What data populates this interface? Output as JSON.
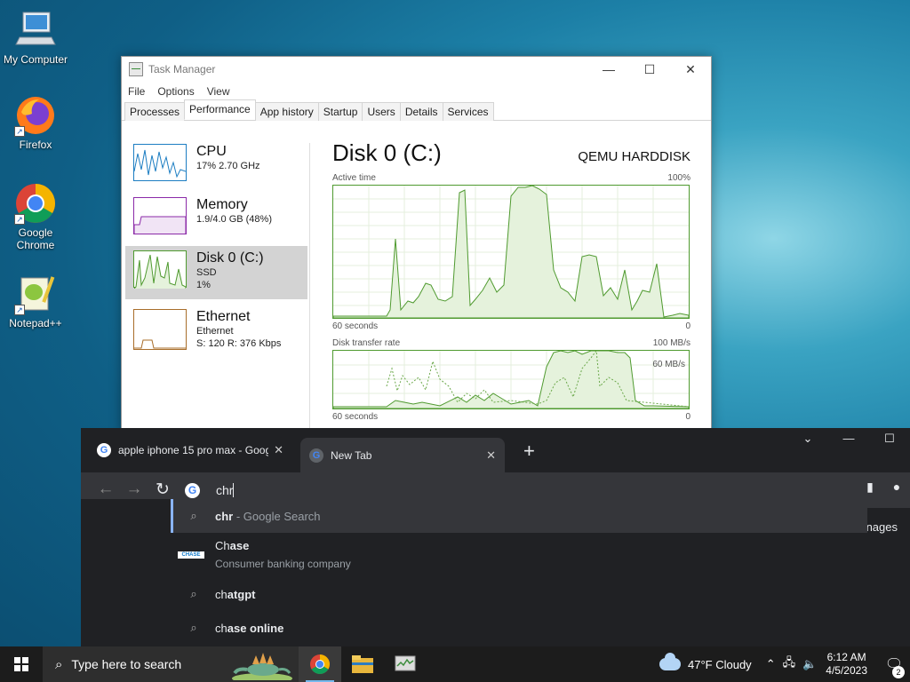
{
  "desktop": {
    "icons": [
      {
        "label": "My Computer"
      },
      {
        "label": "Firefox"
      },
      {
        "label": "Google Chrome"
      },
      {
        "label": "Notepad++"
      }
    ]
  },
  "task_manager": {
    "title": "Task Manager",
    "menu": [
      "File",
      "Options",
      "View"
    ],
    "tabs": [
      "Processes",
      "Performance",
      "App history",
      "Startup",
      "Users",
      "Details",
      "Services"
    ],
    "active_tab": "Performance",
    "resources": [
      {
        "name": "CPU",
        "line1": "17% 2.70 GHz",
        "line2": ""
      },
      {
        "name": "Memory",
        "line1": "1.9/4.0 GB (48%)",
        "line2": ""
      },
      {
        "name": "Disk 0 (C:)",
        "line1": "SSD",
        "line2": "1%"
      },
      {
        "name": "Ethernet",
        "line1": "Ethernet",
        "line2": "S: 120 R: 376 Kbps"
      }
    ],
    "main": {
      "heading": "Disk 0 (C:)",
      "model": "QEMU HARDDISK",
      "graph1": {
        "label_left": "Active time",
        "label_right": "100%",
        "bottom_left": "60 seconds",
        "bottom_right": "0"
      },
      "graph2": {
        "label_left": "Disk transfer rate",
        "label_right": "100 MB/s",
        "inner_label": "60 MB/s",
        "bottom_left": "60 seconds",
        "bottom_right": "0"
      }
    },
    "colors": {
      "accent": "#4f9a2f",
      "selected_bg": "#d3d3d3"
    }
  },
  "chrome": {
    "tabs": [
      {
        "title": "apple iphone 15 pro max - Goog",
        "close": "✕"
      },
      {
        "title": "New Tab",
        "close": "✕"
      }
    ],
    "new_tab": "+",
    "omnibox_text": "chr",
    "suggestions": [
      {
        "bold": "chr",
        "rest": " - Google Search",
        "type": "search"
      },
      {
        "prefix": "Ch",
        "bold": "ase",
        "desc": "Consumer banking company",
        "type": "entity"
      },
      {
        "prefix": "ch",
        "bold": "atgpt",
        "type": "search"
      },
      {
        "prefix": "ch",
        "bold": "ase online",
        "type": "search"
      }
    ],
    "side_text": "nages",
    "chase_logo_text": "CHASE"
  },
  "taskbar": {
    "search_placeholder": "Type here to search",
    "weather": "47°F  Cloudy",
    "time": "6:12 AM",
    "date": "4/5/2023",
    "notification_count": "2"
  }
}
